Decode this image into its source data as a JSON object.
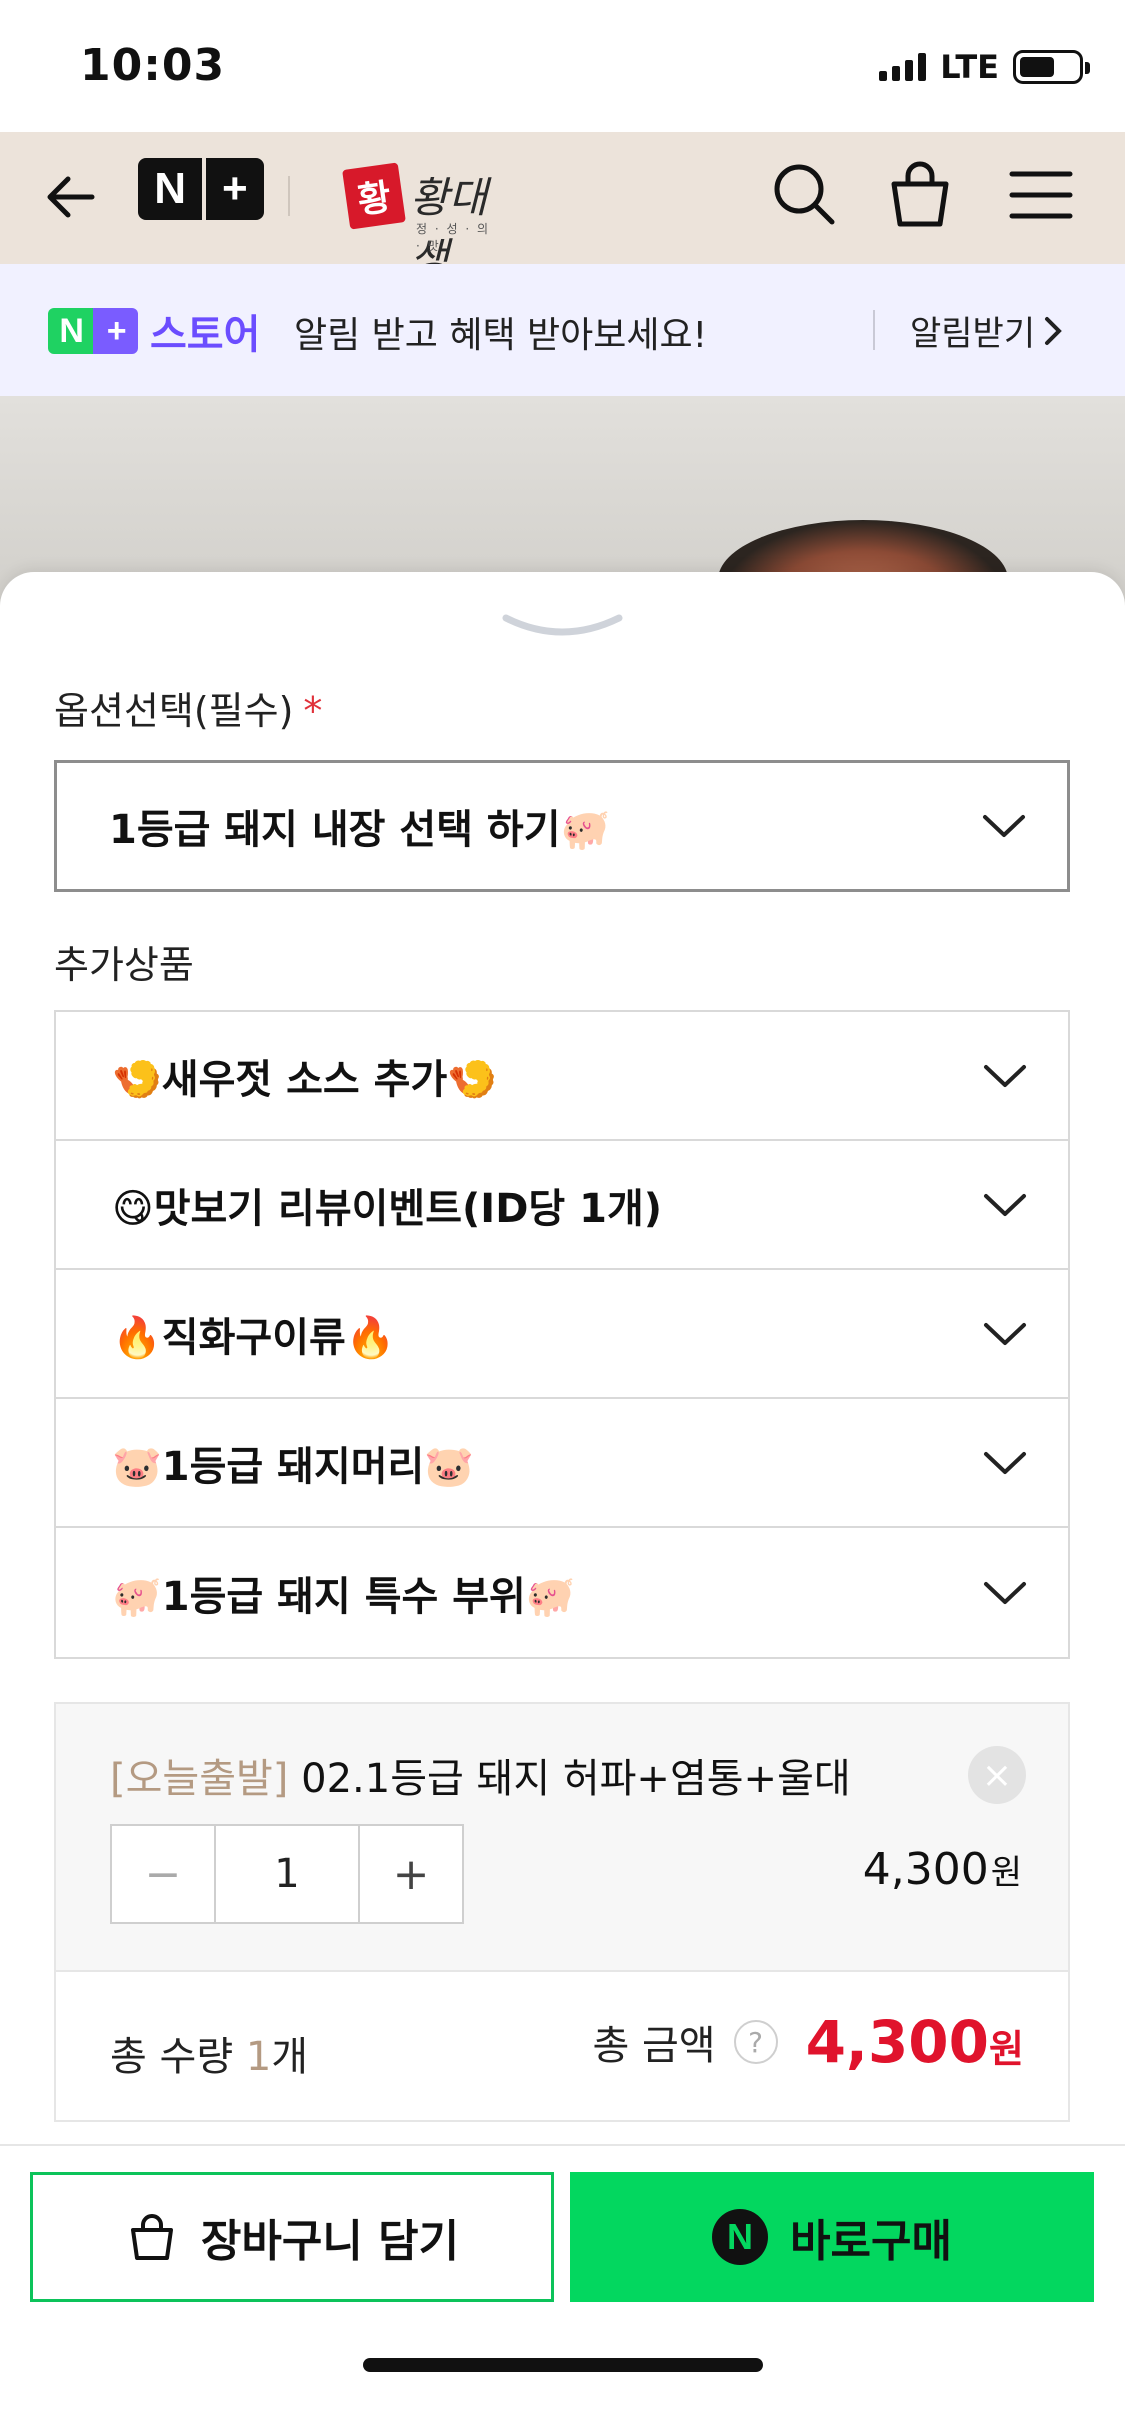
{
  "status_bar": {
    "time": "10:03",
    "network": "LTE"
  },
  "header": {
    "logo_left": "N",
    "logo_right": "+",
    "brand_mark": "황",
    "brand_name": "황대생",
    "brand_sub": "정 · 성 · 의 · 맛",
    "icons": [
      "back-arrow-icon",
      "search-icon",
      "shopping-bag-icon",
      "hamburger-menu-icon"
    ]
  },
  "notice": {
    "badge": "N+",
    "store": "스토어",
    "message": "알림 받고 혜택 받아보세요!",
    "action": "알림받기"
  },
  "options": {
    "label": "옵션선택(필수)",
    "required_mark": "*",
    "selected": "1등급 돼지 내장 선택 하기🐖"
  },
  "addons": {
    "label": "추가상품",
    "items": [
      {
        "label": "🍤새우젓 소스 추가🍤"
      },
      {
        "label": "😋맛보기 리뷰이벤트(ID당 1개)"
      },
      {
        "label": "🔥직화구이류🔥"
      },
      {
        "label": "🐷1등급 돼지머리🐷"
      },
      {
        "label": "🐖1등급 돼지 특수 부위🐖"
      }
    ]
  },
  "selected_item": {
    "tag": "[오늘출발]",
    "name": "02.1등급 돼지 허파+염통+울대",
    "remove": "×",
    "minus": "−",
    "quantity": "1",
    "plus": "+",
    "price": "4,300",
    "price_unit": "원"
  },
  "total": {
    "qty_label": "총 수량",
    "qty_value": "1",
    "qty_unit": "개",
    "amount_label": "총 금액",
    "help": "?",
    "amount": "4,300",
    "amount_unit": "원"
  },
  "actions": {
    "cart": "장바구니 담기",
    "buy_badge": "N",
    "buy": "바로구매"
  },
  "colors": {
    "header_bg": "#ece3da",
    "notice_bg": "#f1f1ff",
    "accent_green": "#03d75f",
    "price_red": "#e0132c",
    "tag_beige": "#b49a82"
  }
}
